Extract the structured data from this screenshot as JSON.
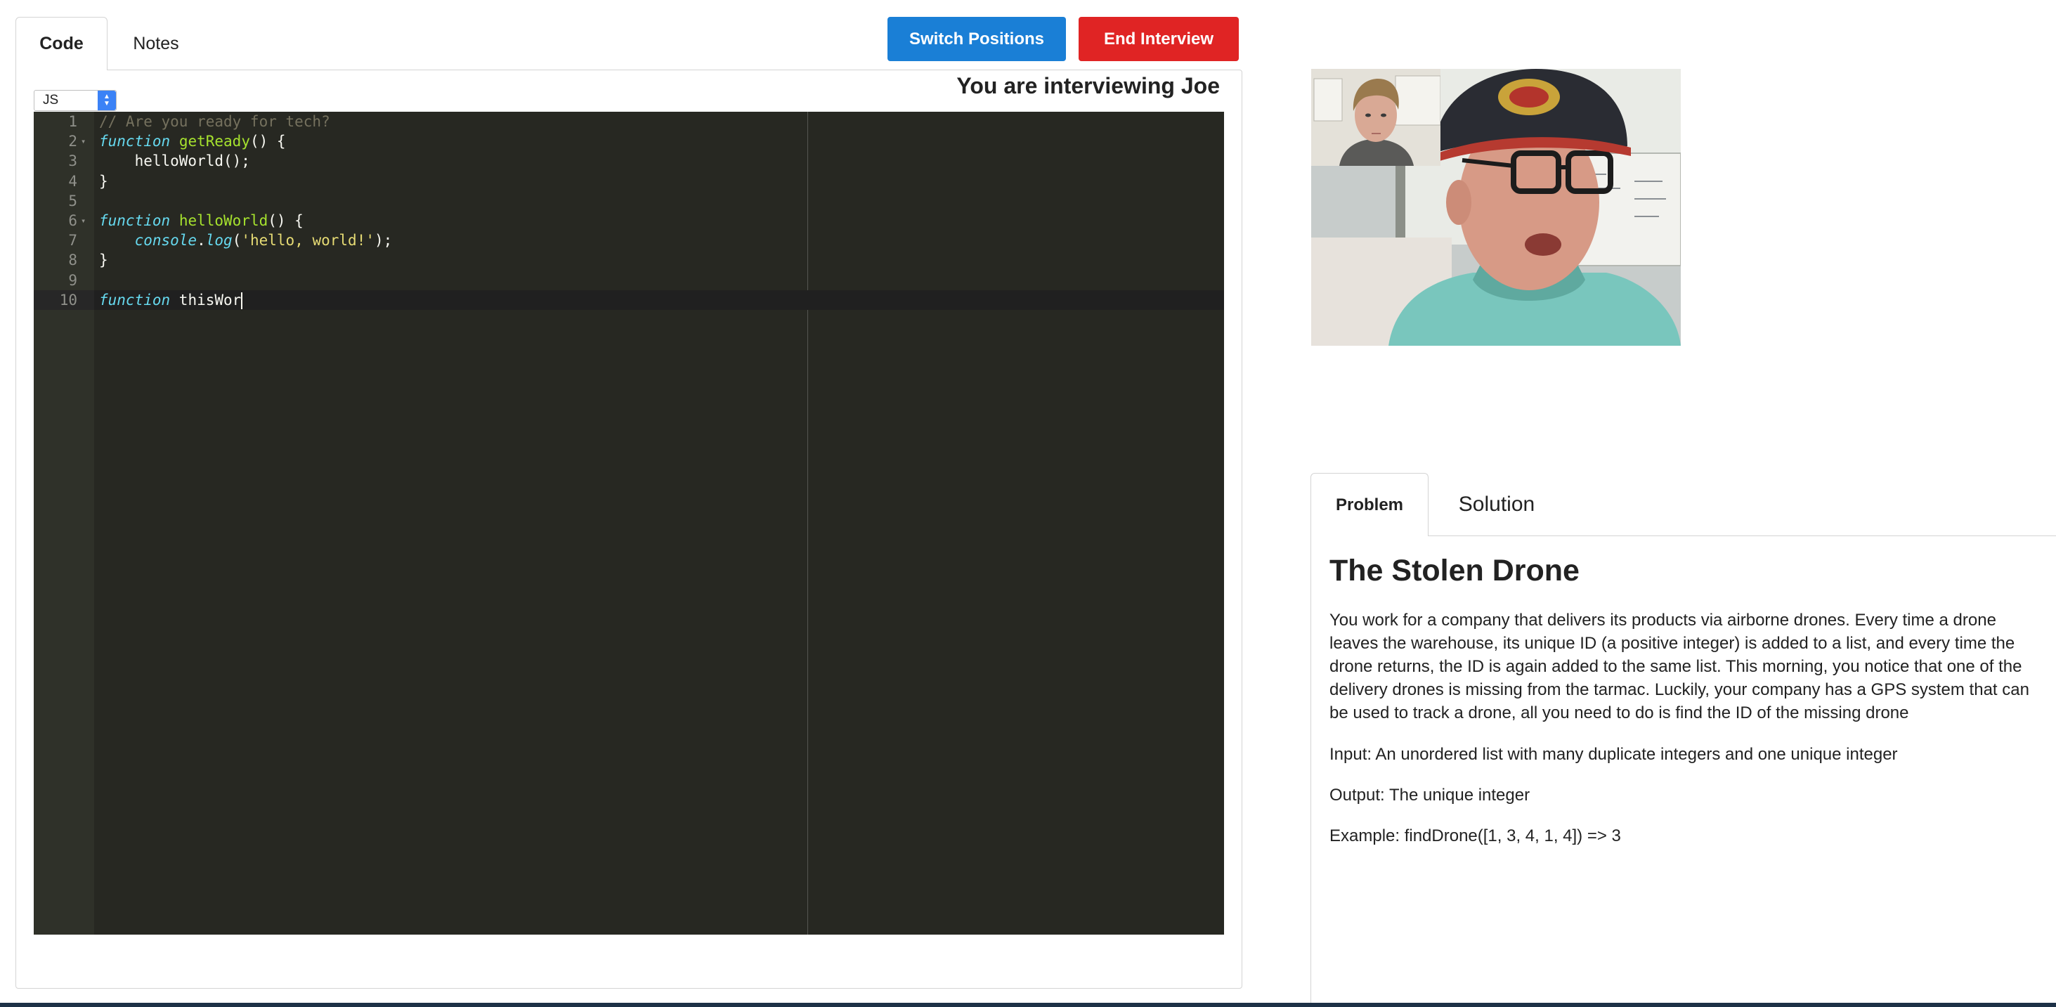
{
  "left_tabs": {
    "code": "Code",
    "notes": "Notes"
  },
  "buttons": {
    "switch_positions": "Switch Positions",
    "end_interview": "End Interview"
  },
  "colors": {
    "switch_button": "#1a7fd6",
    "end_button": "#e02424",
    "editor_bg": "#272822"
  },
  "editor": {
    "language": "JS",
    "interviewing_label": "You are interviewing Joe",
    "lines": [
      {
        "n": "1",
        "fold": "",
        "tokens": [
          {
            "t": "comment",
            "v": "// Are you ready for tech?"
          }
        ]
      },
      {
        "n": "2",
        "fold": "▾",
        "tokens": [
          {
            "t": "storage",
            "v": "function"
          },
          {
            "t": "plain",
            "v": " "
          },
          {
            "t": "fn",
            "v": "getReady"
          },
          {
            "t": "plain",
            "v": "() {"
          }
        ]
      },
      {
        "n": "3",
        "fold": "",
        "tokens": [
          {
            "t": "plain",
            "v": "    helloWorld();"
          }
        ]
      },
      {
        "n": "4",
        "fold": "",
        "tokens": [
          {
            "t": "plain",
            "v": "}"
          }
        ]
      },
      {
        "n": "5",
        "fold": "",
        "tokens": []
      },
      {
        "n": "6",
        "fold": "▾",
        "tokens": [
          {
            "t": "storage",
            "v": "function"
          },
          {
            "t": "plain",
            "v": " "
          },
          {
            "t": "fn",
            "v": "helloWorld"
          },
          {
            "t": "plain",
            "v": "() {"
          }
        ]
      },
      {
        "n": "7",
        "fold": "",
        "tokens": [
          {
            "t": "plain",
            "v": "    "
          },
          {
            "t": "storage",
            "v": "console"
          },
          {
            "t": "plain",
            "v": "."
          },
          {
            "t": "storage_plain",
            "v": "log"
          },
          {
            "t": "plain",
            "v": "("
          },
          {
            "t": "string",
            "v": "'hello, world!'"
          },
          {
            "t": "plain",
            "v": ");"
          }
        ]
      },
      {
        "n": "8",
        "fold": "",
        "tokens": [
          {
            "t": "plain",
            "v": "}"
          }
        ]
      },
      {
        "n": "9",
        "fold": "",
        "tokens": []
      },
      {
        "n": "10",
        "fold": "",
        "active": true,
        "tokens": [
          {
            "t": "storage",
            "v": "function"
          },
          {
            "t": "plain",
            "v": " thisWor"
          },
          {
            "t": "cursor",
            "v": ""
          }
        ]
      }
    ]
  },
  "problem_tabs": {
    "problem": "Problem",
    "solution": "Solution"
  },
  "problem": {
    "title": "The Stolen Drone",
    "description": "You work for a company that delivers its products via airborne drones. Every time a drone leaves the warehouse, its unique ID (a positive integer) is added to a list, and every time the drone returns, the ID is again added to the same list. This morning, you notice that one of the delivery drones is missing from the tarmac. Luckily, your company has a GPS system that can be used to track a drone, all you need to do is find the ID of the missing drone",
    "input": "Input: An unordered list with many duplicate integers and one unique integer",
    "output": "Output: The unique integer",
    "example": "Example: findDrone([1, 3, 4, 1, 4]) => 3"
  }
}
